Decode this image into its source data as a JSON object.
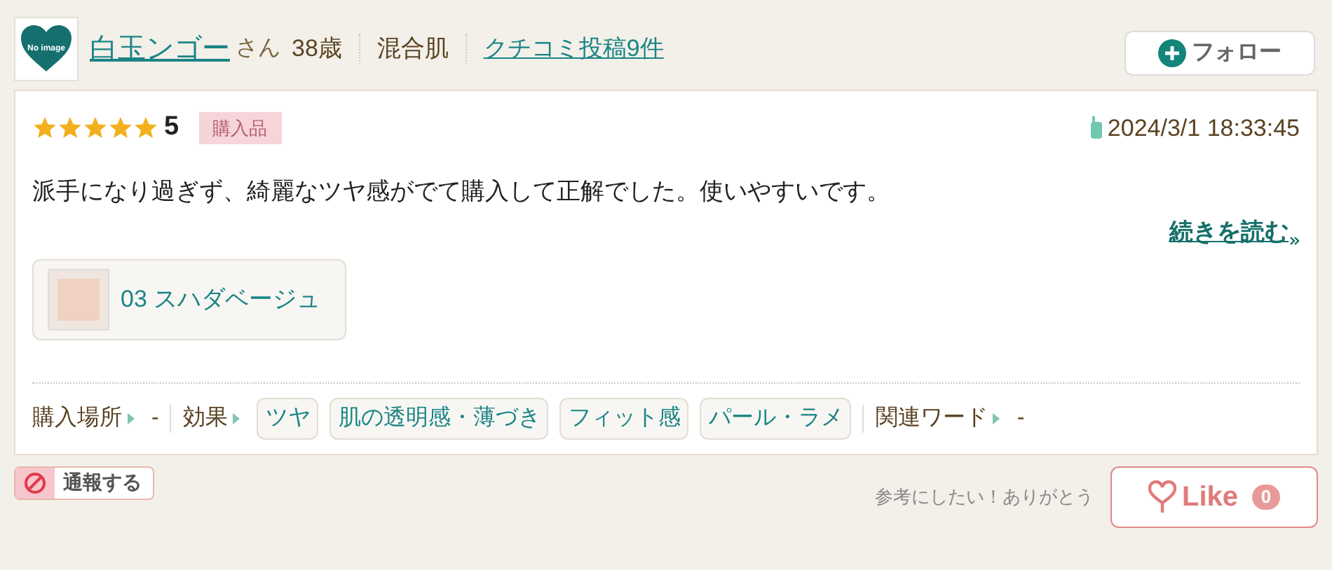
{
  "user": {
    "avatar_label": "No image",
    "name": "白玉ンゴー",
    "honorific": "さん",
    "age": "38歳",
    "skin": "混合肌",
    "posts_link": "クチコミ投稿9件"
  },
  "follow_button": {
    "label": "フォロー"
  },
  "review": {
    "stars": 5,
    "score": "5",
    "badge": "購入品",
    "date": "2024/3/1 18:33:45",
    "body": "派手になり過ぎず、綺麗なツヤ感がでて購入して正解でした。使いやすいです。",
    "read_more": "続きを読む",
    "product": {
      "name": "03 スハダベージュ"
    },
    "meta": [
      {
        "kind": "label",
        "text": "購入場所"
      },
      {
        "kind": "value",
        "text": "-"
      },
      {
        "kind": "label",
        "text": "効果"
      },
      {
        "kind": "tag",
        "text": "ツヤ"
      },
      {
        "kind": "tag",
        "text": "肌の透明感・薄づき"
      },
      {
        "kind": "tag",
        "text": "フィット感"
      },
      {
        "kind": "tag",
        "text": "パール・ラメ"
      },
      {
        "kind": "label",
        "text": "関連ワード"
      },
      {
        "kind": "value",
        "text": "-"
      }
    ]
  },
  "report_button": {
    "label": "通報する"
  },
  "thanks_text": "参考にしたい！ありがとう",
  "like_button": {
    "label": "Like",
    "count": "0"
  }
}
